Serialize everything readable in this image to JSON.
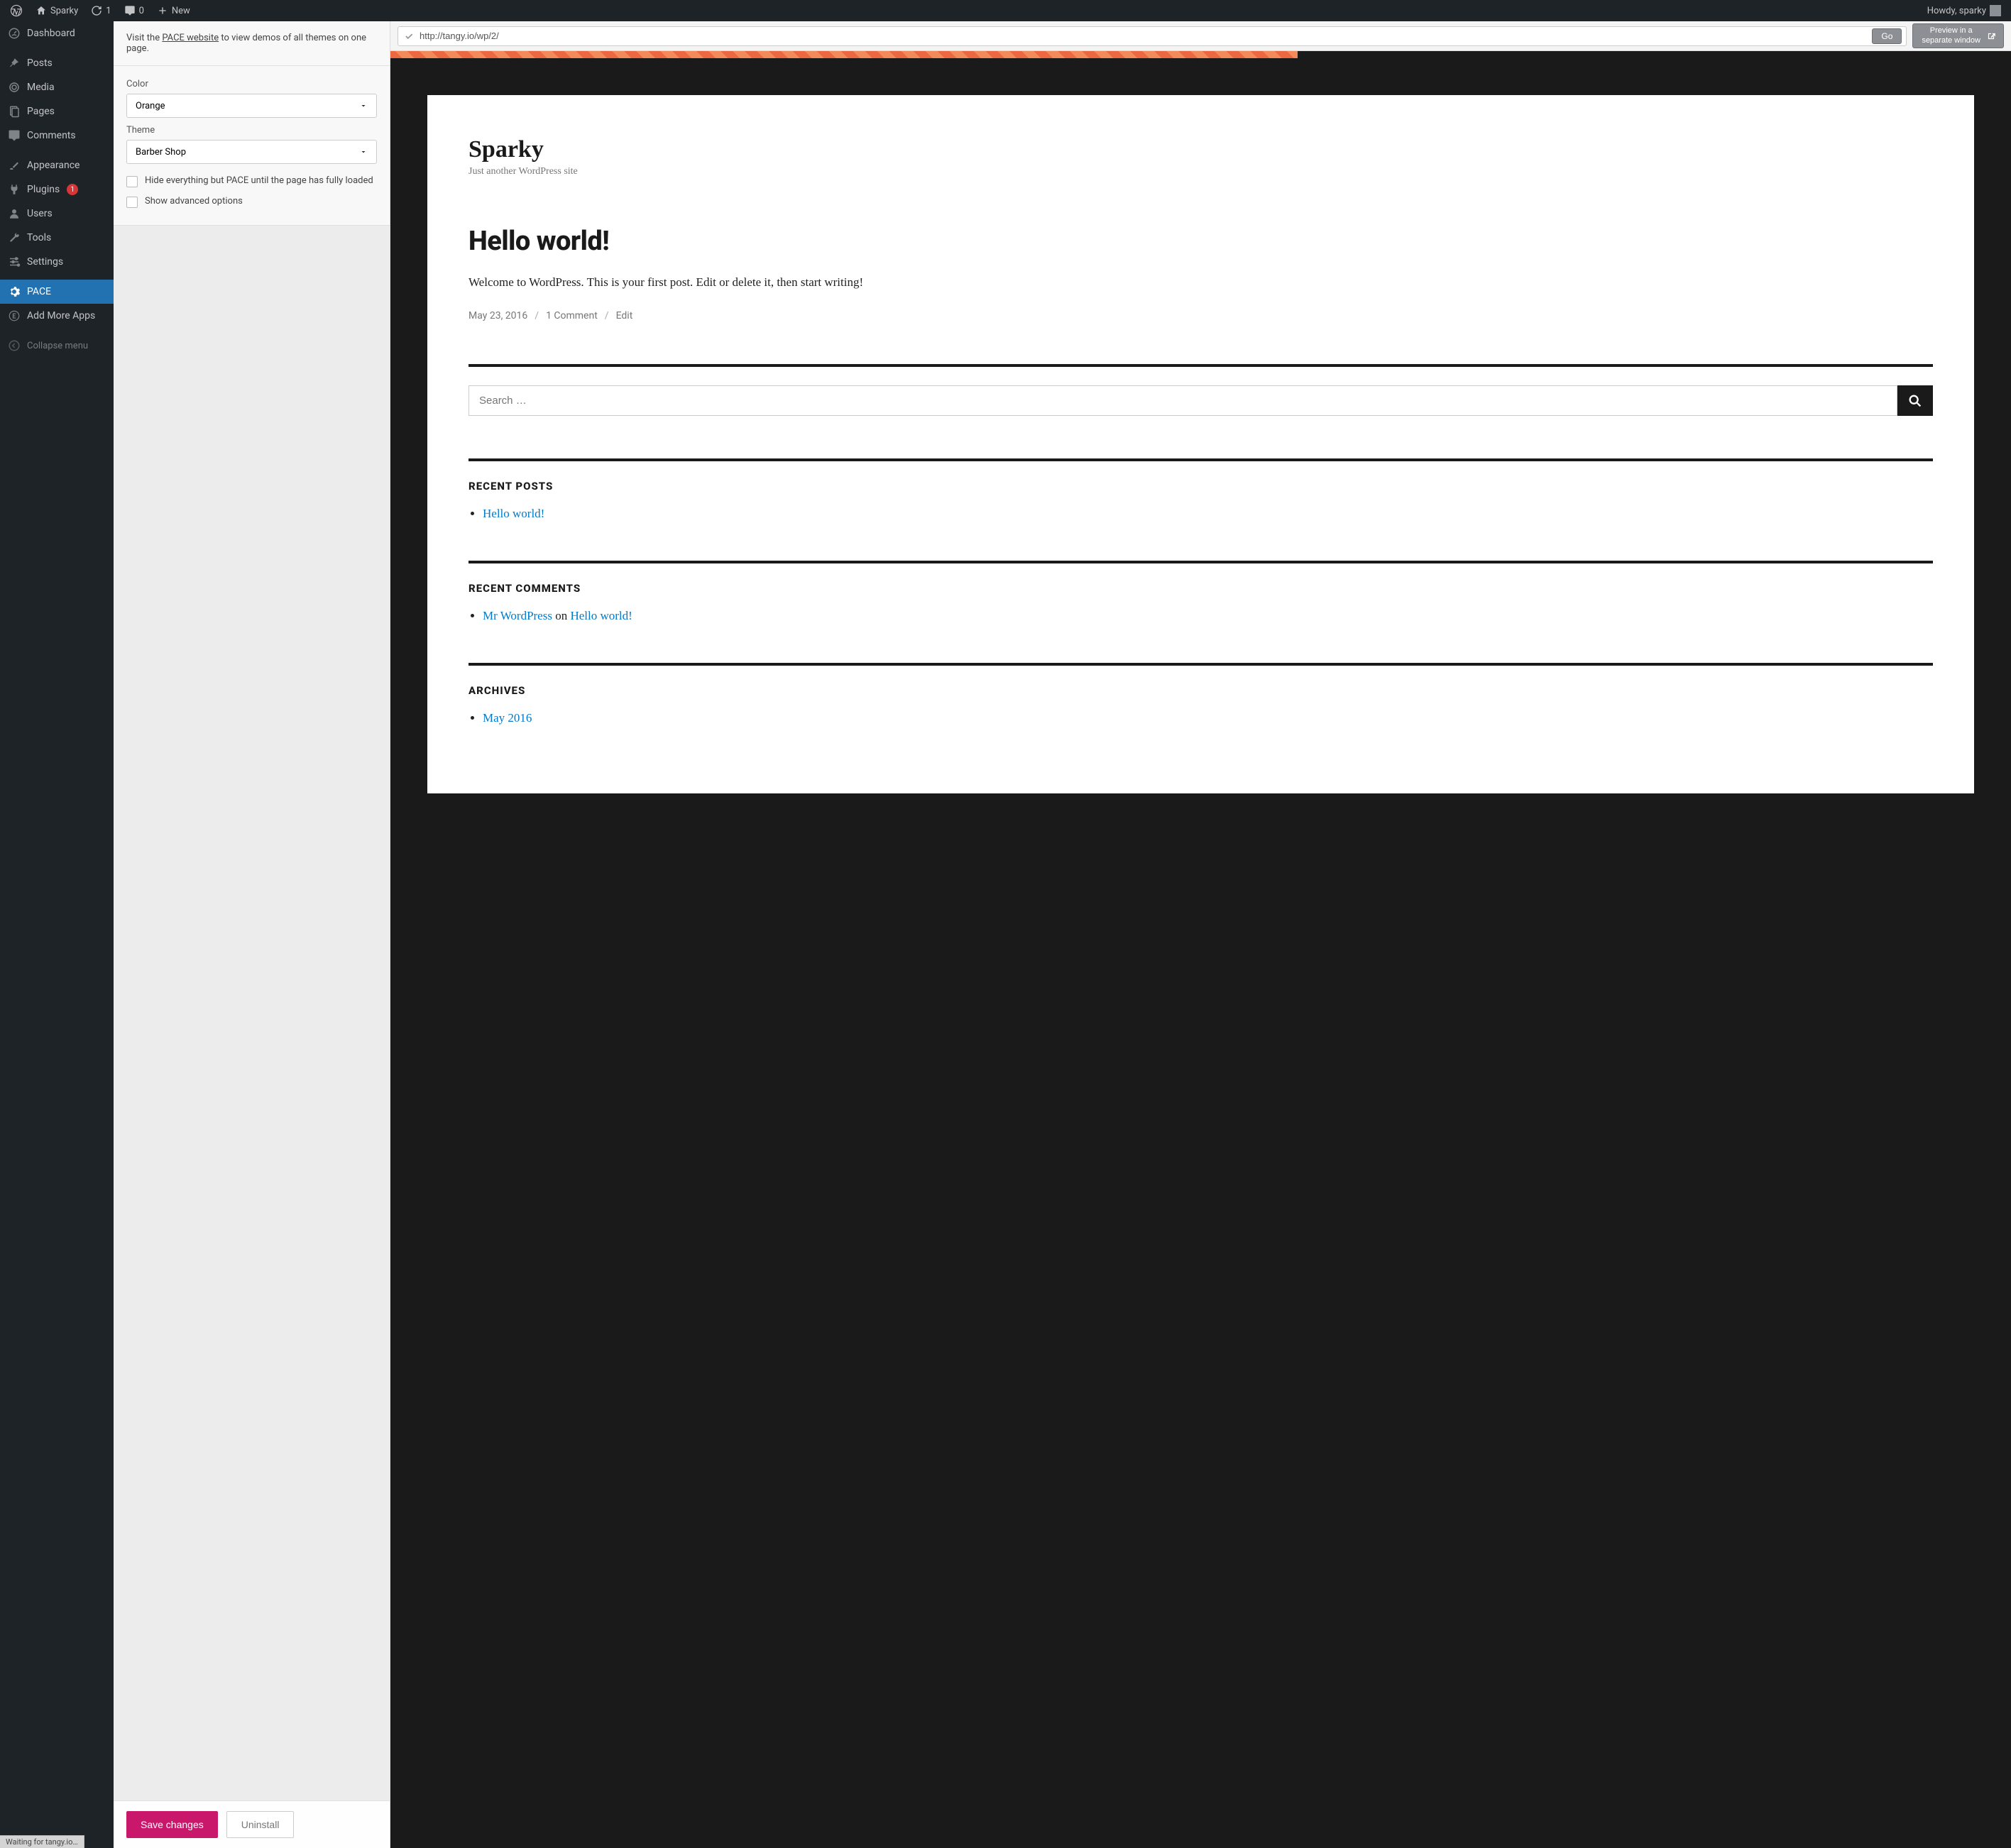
{
  "adminbar": {
    "site_name": "Sparky",
    "updates_count": "1",
    "comments_count": "0",
    "new_label": "New",
    "howdy": "Howdy, sparky"
  },
  "sidebar": {
    "dashboard": "Dashboard",
    "posts": "Posts",
    "media": "Media",
    "pages": "Pages",
    "comments": "Comments",
    "appearance": "Appearance",
    "plugins": "Plugins",
    "plugins_badge": "1",
    "users": "Users",
    "tools": "Tools",
    "settings": "Settings",
    "pace": "PACE",
    "add_more_apps": "Add More Apps",
    "collapse": "Collapse menu"
  },
  "panel": {
    "intro_prefix": "Visit the ",
    "intro_link": "PACE website",
    "intro_suffix": " to view demos of all themes on one page.",
    "color_label": "Color",
    "color_value": "Orange",
    "theme_label": "Theme",
    "theme_value": "Barber Shop",
    "hide_label": "Hide everything but PACE until the page has fully loaded",
    "advanced_label": "Show advanced options",
    "save": "Save changes",
    "uninstall": "Uninstall"
  },
  "preview": {
    "url": "http://tangy.io/wp/2/",
    "go": "Go",
    "preview_window_line1": "Preview in a",
    "preview_window_line2": "separate window",
    "site_title": "Sparky",
    "tagline": "Just another WordPress site",
    "post_title": "Hello world!",
    "post_body": "Welcome to WordPress. This is your first post. Edit or delete it, then start writing!",
    "post_date": "May 23, 2016",
    "post_comments": "1 Comment",
    "post_edit": "Edit",
    "search_placeholder": "Search …",
    "recent_posts_title": "RECENT POSTS",
    "recent_posts": {
      "0": "Hello world!"
    },
    "recent_comments_title": "RECENT COMMENTS",
    "rc_author": "Mr WordPress",
    "rc_on": " on ",
    "rc_post": "Hello world!",
    "archives_title": "ARCHIVES",
    "archives": {
      "0": "May 2016"
    }
  },
  "status": "Waiting for tangy.io…"
}
